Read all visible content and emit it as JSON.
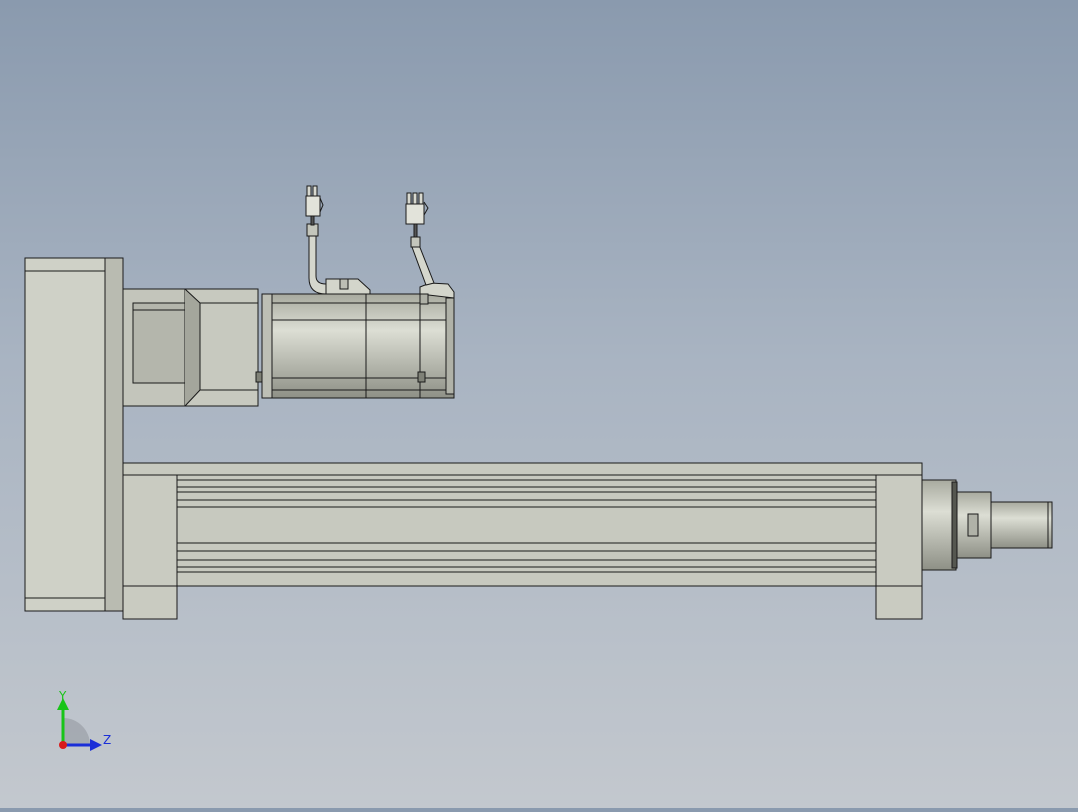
{
  "viewport": {
    "colors": {
      "bg_top": "#8a9aae",
      "bg_bottom": "#c3c8ce",
      "part_fill": "#c9cbc1",
      "part_dark": "#9c9e93",
      "edge": "#1a1a1a"
    }
  },
  "triad": {
    "y_label": "Y",
    "z_label": "Z",
    "icons": [
      "y-axis-arrow-icon",
      "z-axis-arrow-icon",
      "x-axis-dot-icon"
    ],
    "colors": {
      "y": "#18c418",
      "z": "#1a2ed8",
      "x": "#d81a1a"
    }
  }
}
